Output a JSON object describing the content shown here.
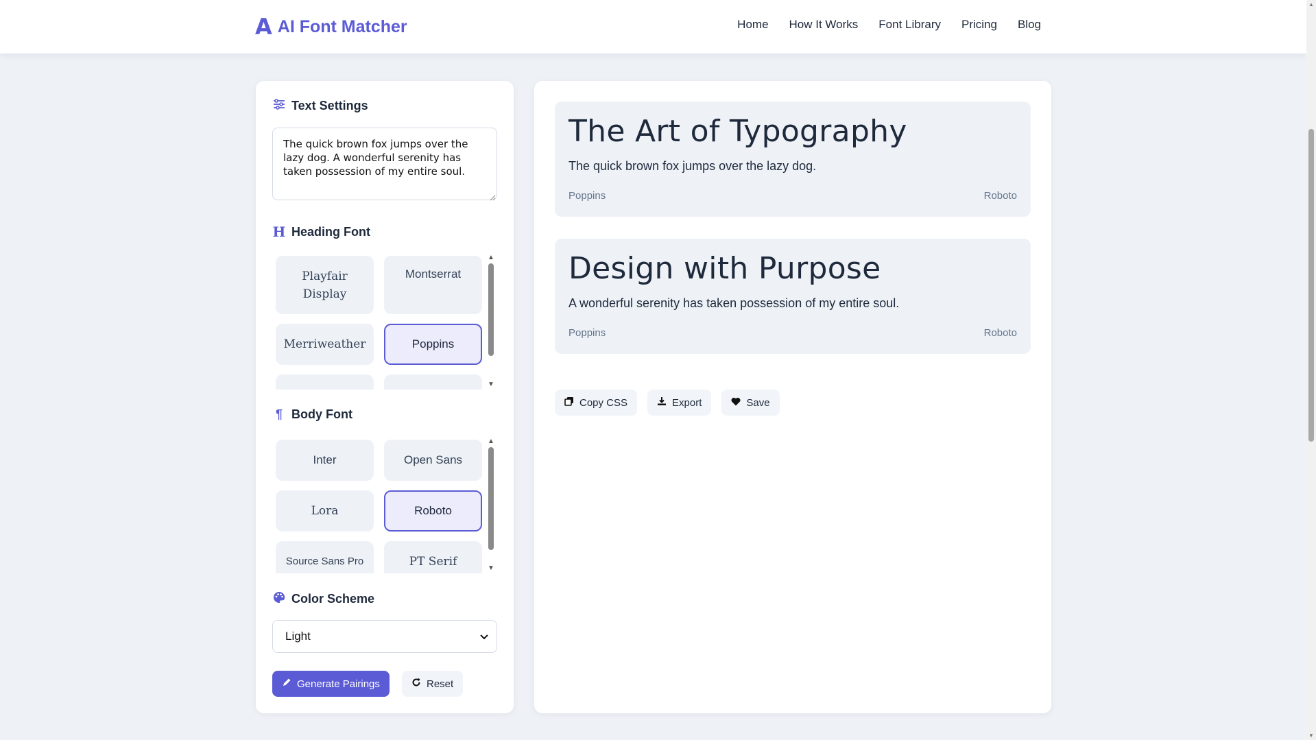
{
  "brand": {
    "icon": "A",
    "name": "AI Font Matcher"
  },
  "nav": [
    "Home",
    "How It Works",
    "Font Library",
    "Pricing",
    "Blog"
  ],
  "sidebar": {
    "text_settings": {
      "title": "Text Settings",
      "icon": "sliders-icon",
      "sample_text": "The quick brown fox jumps over the lazy dog. A wonderful serenity has taken possession of my entire soul."
    },
    "heading_font": {
      "title": "Heading Font",
      "icon": "heading-icon",
      "options": [
        "Playfair Display",
        "Montserrat",
        "Merriweather",
        "Poppins"
      ],
      "selected": "Poppins"
    },
    "body_font": {
      "title": "Body Font",
      "icon": "paragraph-icon",
      "options": [
        "Inter",
        "Open Sans",
        "Lora",
        "Roboto",
        "Source Sans Pro",
        "PT Serif"
      ],
      "selected": "Roboto"
    },
    "color_scheme": {
      "title": "Color Scheme",
      "icon": "palette-icon",
      "value": "Light"
    },
    "generate_label": "Generate Pairings",
    "reset_label": "Reset"
  },
  "preview": {
    "pairings": [
      {
        "heading": "The Art of Typography",
        "body": "The quick brown fox jumps over the lazy dog.",
        "heading_font": "Poppins",
        "body_font": "Roboto"
      },
      {
        "heading": "Design with Purpose",
        "body": "A wonderful serenity has taken possession of my entire soul.",
        "heading_font": "Poppins",
        "body_font": "Roboto"
      }
    ],
    "actions": {
      "copy": "Copy CSS",
      "export": "Export",
      "save": "Save"
    }
  },
  "colors": {
    "accent": "#5b5bd6",
    "background": "#eef2f7",
    "panel": "#ffffff"
  }
}
